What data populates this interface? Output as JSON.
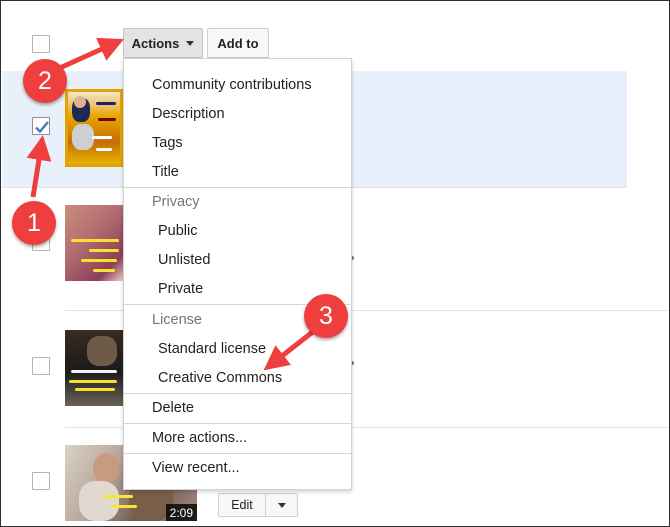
{
  "toolbar": {
    "actions_label": "Actions",
    "add_to_label": "Add to"
  },
  "actions_menu": {
    "items": [
      {
        "label": "Community contributions",
        "kind": "item"
      },
      {
        "label": "Description",
        "kind": "item"
      },
      {
        "label": "Tags",
        "kind": "item"
      },
      {
        "label": "Title",
        "kind": "item"
      }
    ],
    "privacy": {
      "header": "Privacy",
      "options": [
        "Public",
        "Unlisted",
        "Private"
      ]
    },
    "license": {
      "header": "License",
      "options": [
        "Standard license",
        "Creative Commons"
      ]
    },
    "delete_label": "Delete",
    "more_actions_label": "More actions...",
    "view_recent_label": "View recent..."
  },
  "videos": [
    {
      "checked": true,
      "duration": ""
    },
    {
      "checked": false,
      "duration": ""
    },
    {
      "checked": false,
      "duration": ""
    },
    {
      "checked": false,
      "duration": "2:09"
    }
  ],
  "last_row": {
    "edit_label": "Edit"
  },
  "annotations": {
    "step1": "1",
    "step2": "2",
    "step3": "3",
    "color": "#ef3e3e"
  },
  "colors": {
    "selected_row_bg": "#e8f0fb",
    "actions_button_bg": "#e3e3e3",
    "check_color": "#4a78b8"
  }
}
